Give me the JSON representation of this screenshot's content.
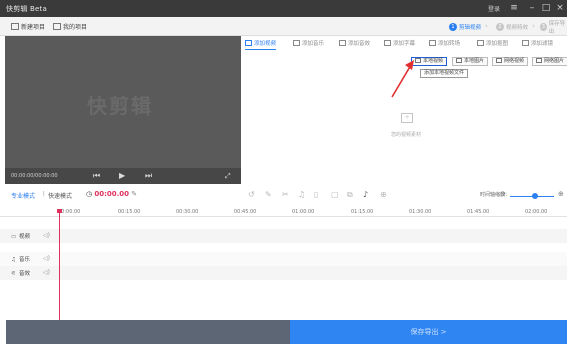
{
  "app": {
    "title": "快剪辑 Beta",
    "login": "登录"
  },
  "menu": {
    "new_project": "新建项目",
    "my_projects": "我的项目"
  },
  "steps": [
    {
      "num": "1",
      "label": "剪辑视频",
      "active": true
    },
    {
      "num": "2",
      "label": "视频特效",
      "active": false
    },
    {
      "num": "3",
      "label": "保存导出",
      "active": false
    }
  ],
  "preview": {
    "watermark": "快剪辑",
    "time": "00:00:00/00:00:00"
  },
  "media_tabs": [
    "添加视频",
    "添加音乐",
    "添加音效",
    "添加字幕",
    "添加转场",
    "添加抠图",
    "添加滤镜"
  ],
  "add_buttons": [
    "本地视频",
    "本地图片",
    "网络视频",
    "网络图片"
  ],
  "tooltip": "添加本地视频文件",
  "empty_hint": "您的视频素材",
  "timeline": {
    "mode_pro": "专业模式",
    "mode_fast": "快速模式",
    "timecode": "00:00.00",
    "zoom_label": "时间轴缩放：",
    "ticks": [
      "00:00.00",
      "00:15.00",
      "00:30.00",
      "00:45.00",
      "01:00.00",
      "01:15.00",
      "01:30.00",
      "01:45.00",
      "02:00.00"
    ],
    "tracks": {
      "video": "视频",
      "audio": "音乐",
      "sfx": "音效"
    }
  },
  "export": {
    "label": "保存导出 >"
  },
  "colors": {
    "accent": "#2b7ff0",
    "timecode": "#e0325f",
    "save": "#2f86f2"
  }
}
